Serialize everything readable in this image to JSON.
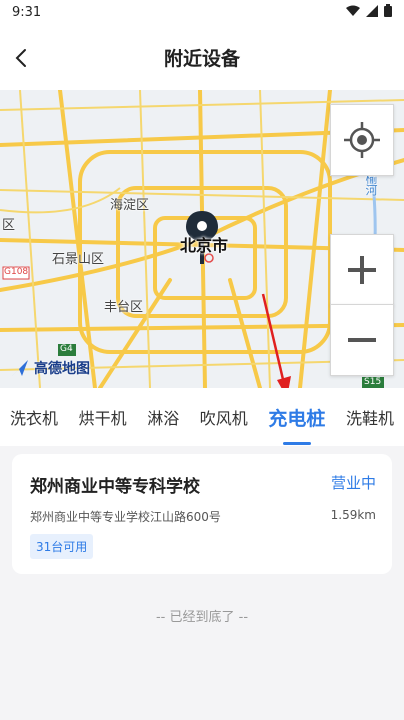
{
  "status_bar": {
    "time": "9:31"
  },
  "header": {
    "title": "附近设备"
  },
  "map": {
    "labels": {
      "haidian": "海淀区",
      "shijingshan": "石景山区",
      "fengtai": "丰台区",
      "west_district": "区",
      "city": "北京市",
      "road_g108": "G108",
      "road_g4": "G4",
      "road_s15": "S15",
      "right_vertical": "高榆河"
    },
    "logo": "高德地图"
  },
  "tabs": [
    "洗衣机",
    "烘干机",
    "淋浴",
    "吹风机",
    "充电桩",
    "洗鞋机"
  ],
  "active_tab": "充电桩",
  "card": {
    "name": "郑州商业中等专科学校",
    "status": "营业中",
    "address": "郑州商业中等专业学校江山路600号",
    "distance": "1.59km",
    "badge": "31台可用"
  },
  "footer": {
    "end_text": "-- 已经到底了 --"
  },
  "colors": {
    "accent": "#2e7be6",
    "road": "#f7c948"
  }
}
